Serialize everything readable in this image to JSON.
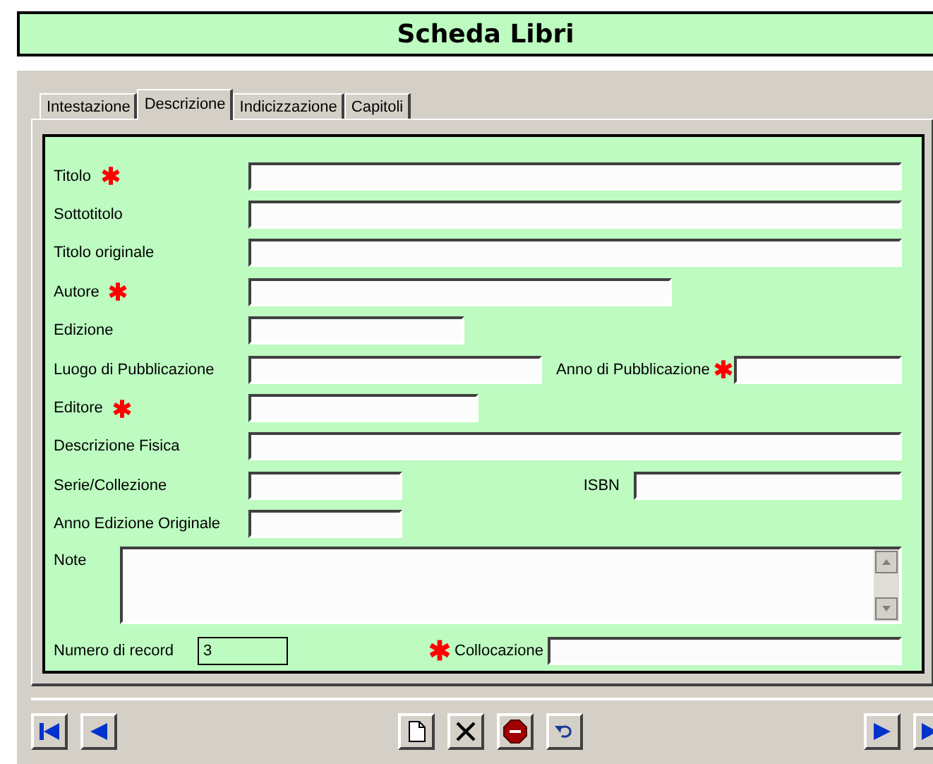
{
  "title": "Scheda Libri",
  "tabs": [
    {
      "label": "Intestazione",
      "selected": false
    },
    {
      "label": "Descrizione",
      "selected": true
    },
    {
      "label": "Indicizzazione",
      "selected": false
    },
    {
      "label": "Capitoli",
      "selected": false
    }
  ],
  "fields": [
    {
      "label": "Titolo",
      "required": true
    },
    {
      "label": "Sottotitolo",
      "required": false
    },
    {
      "label": "Titolo originale",
      "required": false
    },
    {
      "label": "Autore",
      "required": true
    },
    {
      "label": "Edizione",
      "required": false
    },
    {
      "label": "Luogo di Pubblicazione",
      "required": false
    },
    {
      "label": "Anno di Pubblicazione",
      "required": true
    },
    {
      "label": "Editore",
      "required": true
    },
    {
      "label": "Descrizione Fisica",
      "required": false
    },
    {
      "label": "Serie/Collezione",
      "required": false
    },
    {
      "label": "ISBN",
      "required": false
    },
    {
      "label": "Anno Edizione Originale",
      "required": false
    }
  ],
  "note": {
    "label": "Note"
  },
  "record": {
    "label": "Numero di record",
    "value": "3"
  },
  "location": {
    "label": "Collocazione",
    "required": true
  }
}
